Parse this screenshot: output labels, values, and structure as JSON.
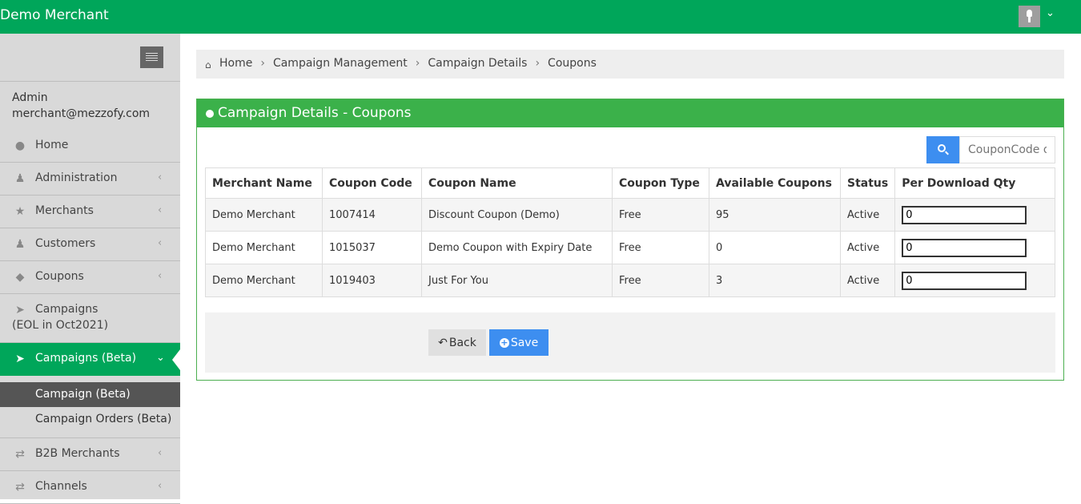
{
  "app": {
    "title": "Demo Merchant"
  },
  "user": {
    "role": "Admin",
    "email": "merchant@mezzofy.com"
  },
  "sidebar": {
    "items": [
      {
        "label": "Home",
        "icon": "home-circle-icon"
      },
      {
        "label": "Administration",
        "icon": "user-icon"
      },
      {
        "label": "Merchants",
        "icon": "star-icon"
      },
      {
        "label": "Customers",
        "icon": "users-icon"
      },
      {
        "label": "Coupons",
        "icon": "tag-icon"
      },
      {
        "label": "Campaigns",
        "label2": "(EOL in Oct2021)",
        "icon": "rocket-icon"
      },
      {
        "label": "Campaigns (Beta)",
        "icon": "rocket-icon",
        "active": true
      },
      {
        "label": "B2B Merchants",
        "icon": "exchange-icon"
      },
      {
        "label": "Channels",
        "icon": "exchange-icon"
      }
    ],
    "sub_items": [
      {
        "label": "Campaign (Beta)",
        "selected": true
      },
      {
        "label": "Campaign Orders (Beta)"
      }
    ]
  },
  "breadcrumb": [
    "Home",
    "Campaign Management",
    "Campaign Details",
    "Coupons"
  ],
  "panel": {
    "title": "Campaign Details - Coupons",
    "search_placeholder": "CouponCode or"
  },
  "table": {
    "headers": [
      "Merchant Name",
      "Coupon Code",
      "Coupon Name",
      "Coupon Type",
      "Available Coupons",
      "Status",
      "Per Download Qty"
    ],
    "rows": [
      {
        "merchant": "Demo Merchant",
        "code": "1007414",
        "name": "Discount Coupon (Demo)",
        "type": "Free",
        "available": "95",
        "status": "Active",
        "qty": "0"
      },
      {
        "merchant": "Demo Merchant",
        "code": "1015037",
        "name": "Demo Coupon with Expiry Date",
        "type": "Free",
        "available": "0",
        "status": "Active",
        "qty": "0"
      },
      {
        "merchant": "Demo Merchant",
        "code": "1019403",
        "name": "Just For You",
        "type": "Free",
        "available": "3",
        "status": "Active",
        "qty": "0"
      }
    ]
  },
  "buttons": {
    "back": "Back",
    "save": "Save"
  },
  "colors": {
    "brand": "#00a65a",
    "panel_header": "#3bb14a",
    "primary": "#3d8ef0"
  }
}
